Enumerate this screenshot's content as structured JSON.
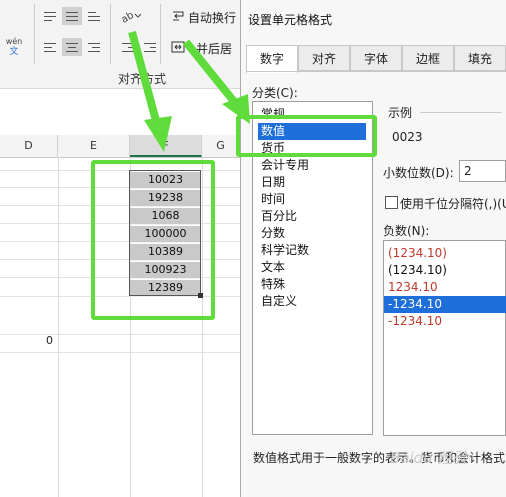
{
  "ribbon": {
    "wrap_text": "自动换行",
    "merge_center": "并后居",
    "alignment_group": "对齐方式",
    "font_size_label": "wén"
  },
  "sheet": {
    "col_d": "D",
    "col_e": "E",
    "col_f": "F",
    "col_g": "G",
    "cells": [
      "10023",
      "19238",
      "1068",
      "100000",
      "10389",
      "100923",
      "12389"
    ],
    "zero_cell": "0"
  },
  "dialog": {
    "title": "设置单元格格式",
    "tabs": [
      "数字",
      "对齐",
      "字体",
      "边框",
      "填充"
    ],
    "category_label": "分类(C):",
    "categories": [
      "常规",
      "数值",
      "货币",
      "会计专用",
      "日期",
      "时间",
      "百分比",
      "分数",
      "科学记数",
      "文本",
      "特殊",
      "自定义"
    ],
    "selected_category": "数值",
    "sample_label": "示例",
    "sample_value": "0023",
    "decimal_label": "小数位数(D):",
    "decimal_value": "2",
    "separator_label": "使用千位分隔符(,)(U",
    "negative_label": "负数(N):",
    "negatives": [
      {
        "text": "(1234.10)",
        "color": "#c0392b"
      },
      {
        "text": "(1234.10)",
        "color": "#111111"
      },
      {
        "text": "1234.10",
        "color": "#c0392b"
      },
      {
        "text": "-1234.10",
        "color": "#ffffff"
      },
      {
        "text": "-1234.10",
        "color": "#c0392b"
      }
    ],
    "description": "数值格式用于一般数字的表示。货币和会计格式",
    "watermark": "Baidu 经验"
  },
  "colors": {
    "annotation_green": "#5fdc3c",
    "selection_blue": "#1e6fd9",
    "selected_cell_gray": "#c9c9c9"
  }
}
